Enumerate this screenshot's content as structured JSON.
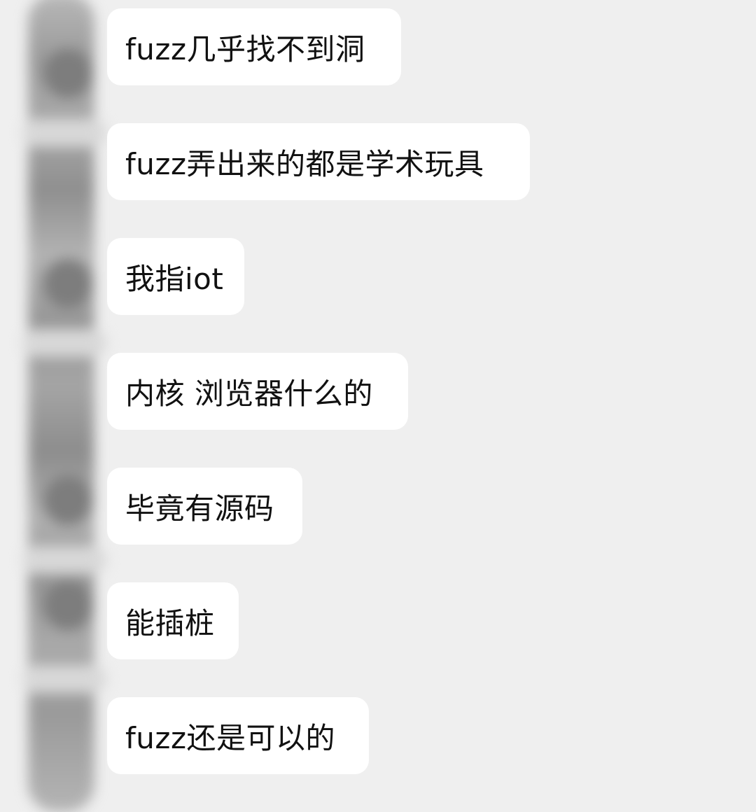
{
  "messages": [
    {
      "text": "fuzz几乎找不到洞"
    },
    {
      "text": "fuzz弄出来的都是学术玩具"
    },
    {
      "text": "我指iot"
    },
    {
      "text": "内核 浏览器什么的"
    },
    {
      "text": "毕竟有源码"
    },
    {
      "text": "能插桩"
    },
    {
      "text": "fuzz还是可以的"
    }
  ],
  "colors": {
    "background": "#efefef",
    "bubble": "#ffffff",
    "text": "#111111"
  }
}
